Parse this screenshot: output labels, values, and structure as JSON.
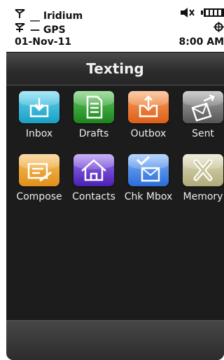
{
  "status": {
    "network_name": "Iridium",
    "network_prefix": "__",
    "gps_label": "GPS",
    "gps_prefix": "—",
    "date": "01-Nov-11",
    "time": "8:00 AM",
    "icons": [
      "antenna-icon",
      "mute-icon",
      "battery-icon",
      "gps-crosshair-icon"
    ]
  },
  "header": {
    "title": "Texting"
  },
  "apps": [
    {
      "label": "Inbox",
      "color": "#2db8d8",
      "icon": "inbox-icon"
    },
    {
      "label": "Drafts",
      "color": "#2e9d2e",
      "icon": "drafts-icon"
    },
    {
      "label": "Outbox",
      "color": "#e8742a",
      "icon": "outbox-icon"
    },
    {
      "label": "Sent",
      "color": "#6e6e6e",
      "icon": "sent-icon"
    },
    {
      "label": "Compose",
      "color": "#e89a28",
      "icon": "compose-icon"
    },
    {
      "label": "Contacts",
      "color": "#5a2ec8",
      "icon": "contacts-icon"
    },
    {
      "label": "Chk Mbox",
      "color": "#3a7ce0",
      "icon": "check-mailbox-icon"
    },
    {
      "label": "Memory",
      "color": "#c9c49a",
      "icon": "memory-icon"
    }
  ]
}
